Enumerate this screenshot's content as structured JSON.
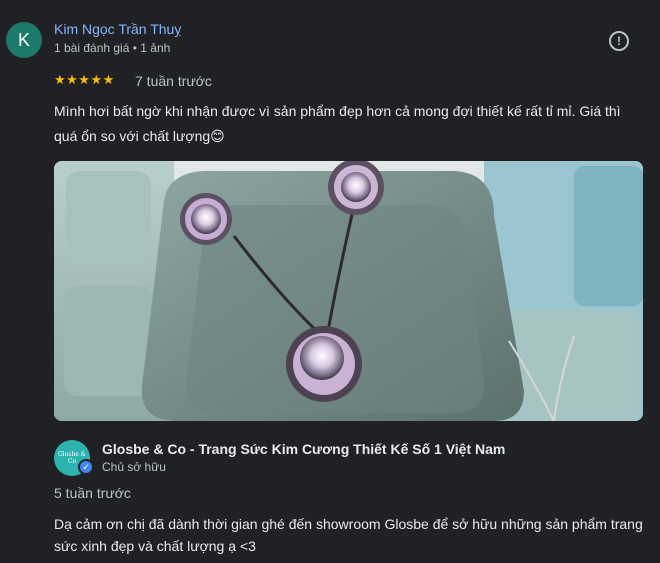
{
  "review": {
    "avatar_letter": "K",
    "reviewer_name": "Kim Ngọc Trần Thuỵ",
    "reviewer_meta": "1 bài đánh giá • 1 ảnh",
    "stars": "★★★★★",
    "rating": 5,
    "time": "7 tuần trước",
    "text": "Mình hơi bất ngờ khi nhận được vì sản phẩm đẹp hơn cả mong đợi thiết kế rất tỉ mỉ. Giá thì quá ổn so với chất lượng😊",
    "report_icon": "!"
  },
  "owner_reply": {
    "logo_text": "Glosbe & Co",
    "verified_icon": "✓",
    "name": "Glosbe & Co - Trang Sức Kim Cương Thiết Kế Số 1 Việt Nam",
    "role": "Chủ sở hữu",
    "time": "5 tuần trước",
    "text": "Dạ cảm ơn chị đã dành thời gian ghé đến showroom Glosbe để sở hữu những sản phẩm trang sức xinh đẹp và chất lượng ạ <3"
  },
  "colors": {
    "background": "#202124",
    "link_name": "#8ab4f8",
    "star": "#fbbc04",
    "avatar": "#1b7a6b",
    "owner_logo": "#2bb3b0",
    "verified": "#4285f4"
  }
}
